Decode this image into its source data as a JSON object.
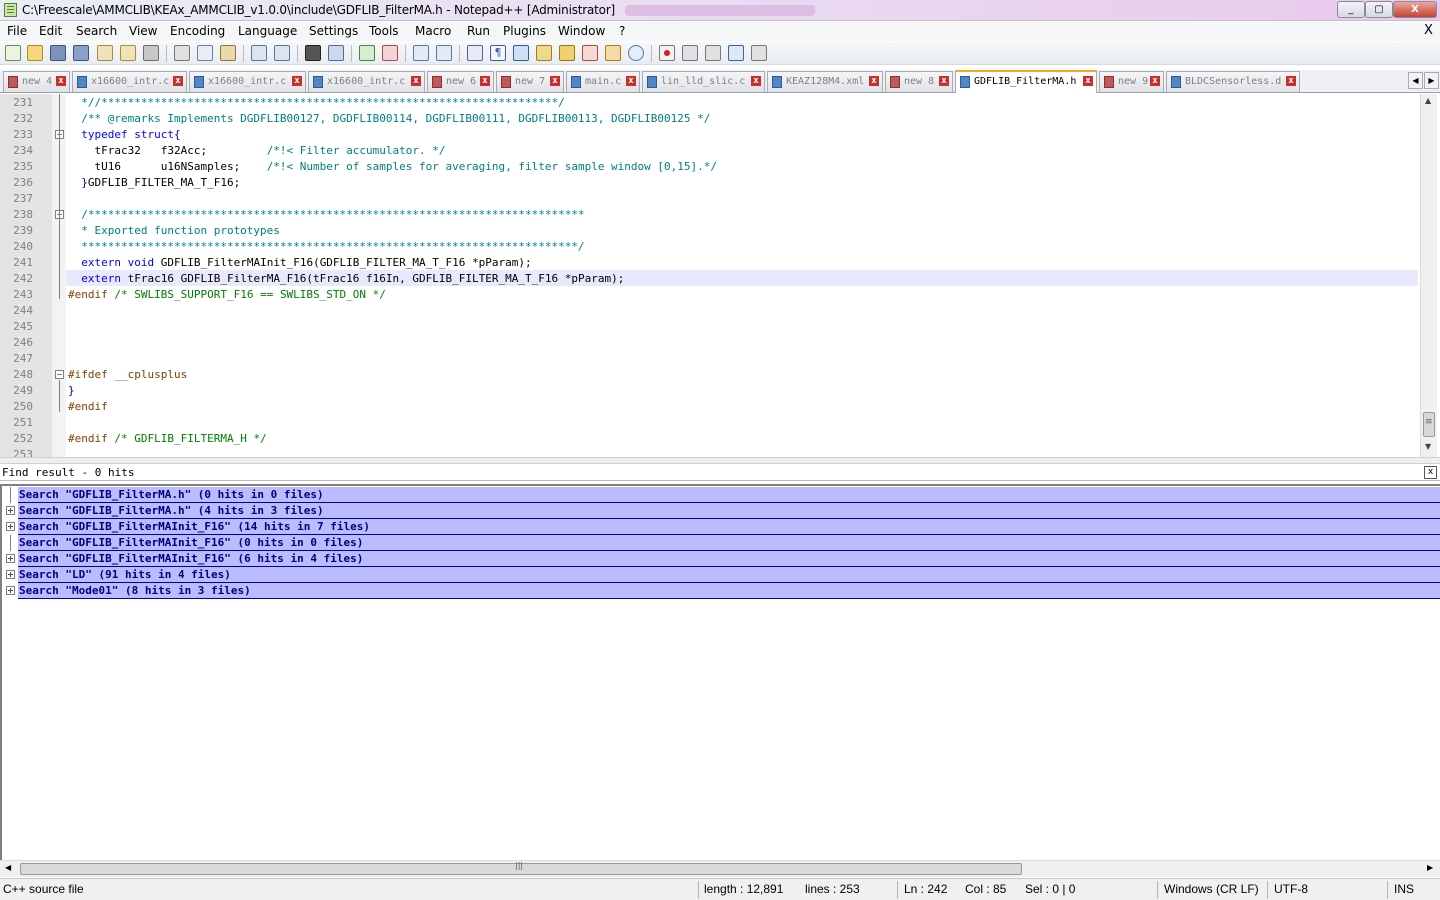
{
  "window": {
    "title": "C:\\Freescale\\AMMCLIB\\KEAx_AMMCLIB_v1.0.0\\include\\GDFLIB_FilterMA.h - Notepad++ [Administrator]",
    "min_label": "_",
    "max_label": "▢",
    "close_label": "X"
  },
  "menu": {
    "items": [
      "File",
      "Edit",
      "Search",
      "View",
      "Encoding",
      "Language",
      "Settings",
      "Tools",
      "Macro",
      "Run",
      "Plugins",
      "Window",
      "?"
    ],
    "close_label": "X"
  },
  "toolbar": {
    "icons": [
      "new-file-icon",
      "open-file-icon",
      "save-icon",
      "save-all-icon",
      "close-icon",
      "close-all-icon",
      "print-icon",
      "cut-icon",
      "copy-icon",
      "paste-icon",
      "undo-icon",
      "redo-icon",
      "find-icon",
      "replace-icon",
      "zoom-in-icon",
      "zoom-out-icon",
      "sync-vertical-icon",
      "sync-horizontal-icon",
      "word-wrap-icon",
      "show-all-chars-icon",
      "indent-guide-icon",
      "user-lang-icon",
      "doc-map-icon",
      "function-list-icon",
      "folder-workspace-icon",
      "monitoring-icon",
      "record-macro-icon",
      "stop-macro-icon",
      "play-macro-icon",
      "run-macro-multiple-icon",
      "save-macro-icon"
    ]
  },
  "tabs": [
    {
      "label": "new 4",
      "active": false,
      "unsaved": true
    },
    {
      "label": "x16600_intr.c",
      "active": false,
      "unsaved": false
    },
    {
      "label": "x16600_intr.c",
      "active": false,
      "unsaved": false
    },
    {
      "label": "x16600_intr.c",
      "active": false,
      "unsaved": false
    },
    {
      "label": "new 6",
      "active": false,
      "unsaved": true
    },
    {
      "label": "new 7",
      "active": false,
      "unsaved": true
    },
    {
      "label": "main.c",
      "active": false,
      "unsaved": false
    },
    {
      "label": "lin_lld_slic.c",
      "active": false,
      "unsaved": false
    },
    {
      "label": "KEAZ128M4.xml",
      "active": false,
      "unsaved": false
    },
    {
      "label": "new 8",
      "active": false,
      "unsaved": true
    },
    {
      "label": "GDFLIB_FilterMA.h",
      "active": true,
      "unsaved": false
    },
    {
      "label": "new 9",
      "active": false,
      "unsaved": true
    },
    {
      "label": "BLDCSensorless.d",
      "active": false,
      "unsaved": false
    }
  ],
  "tab_nav": {
    "prev": "◀",
    "next": "▶"
  },
  "editor": {
    "lines": [
      {
        "n": "231",
        "html": "<span class=\"cm\">  *//*********************************************************************/</span>"
      },
      {
        "n": "232",
        "html": "<span class=\"cm\">  /** @remarks Implements DGDFLIB00127, DGDFLIB00114, DGDFLIB00111, DGDFLIB00113, DGDFLIB00125 */</span>"
      },
      {
        "n": "233",
        "html": "  <span class=\"k\">typedef</span> <span class=\"k\">struct</span><span class=\"br\">{</span>"
      },
      {
        "n": "234",
        "html": "    tFrac32   f32Acc;         <span class=\"cm\">/*!&lt; Filter accumulator. */</span>"
      },
      {
        "n": "235",
        "html": "    tU16      u16NSamples;    <span class=\"cm\">/*!&lt; Number of samples for averaging, filter sample window [0,15].*/</span>"
      },
      {
        "n": "236",
        "html": "  <span class=\"br\">}</span>GDFLIB_FILTER_MA_T_F16;"
      },
      {
        "n": "237",
        "html": ""
      },
      {
        "n": "238",
        "html": "<span class=\"cm\">  /***************************************************************************</span>"
      },
      {
        "n": "239",
        "html": "<span class=\"cm\">  * Exported function prototypes</span>"
      },
      {
        "n": "240",
        "html": "<span class=\"cm\">  ***************************************************************************/</span>"
      },
      {
        "n": "241",
        "html": "  <span class=\"k\">extern</span> <span class=\"k\">void</span> GDFLIB_FilterMAInit_F16(GDFLIB_FILTER_MA_T_F16 *pParam);"
      },
      {
        "n": "242",
        "html": "  <span class=\"k\">extern</span> tFrac16 GDFLIB_FilterMA_F16(tFrac16 f16In, GDFLIB_FILTER_MA_T_F16 *pParam);"
      },
      {
        "n": "243",
        "html": "<span class=\"pp\">#endif</span> <span class=\"cg\">/* SWLIBS_SUPPORT_F16 == SWLIBS_STD_ON */</span>"
      },
      {
        "n": "244",
        "html": ""
      },
      {
        "n": "245",
        "html": ""
      },
      {
        "n": "246",
        "html": ""
      },
      {
        "n": "247",
        "html": ""
      },
      {
        "n": "248",
        "html": "<span class=\"pp\">#ifdef</span> <span class=\"pp\">__cplusplus</span>"
      },
      {
        "n": "249",
        "html": "<span class=\"br\">}</span>"
      },
      {
        "n": "250",
        "html": "<span class=\"pp\">#endif</span>"
      },
      {
        "n": "251",
        "html": ""
      },
      {
        "n": "252",
        "html": "<span class=\"pp\">#endif</span> <span class=\"cg\">/* GDFLIB_FILTERMA_H */</span>"
      },
      {
        "n": "253",
        "html": ""
      }
    ]
  },
  "find_panel": {
    "title": "Find result - 0 hits",
    "close_label": "x",
    "results": [
      {
        "text": "Search \"GDFLIB_FilterMA.h\" (0 hits in 0 files)",
        "expandable": false
      },
      {
        "text": "Search \"GDFLIB_FilterMA.h\" (4 hits in 3 files)",
        "expandable": true
      },
      {
        "text": "Search \"GDFLIB_FilterMAInit_F16\" (14 hits in 7 files)",
        "expandable": true
      },
      {
        "text": "Search \"GDFLIB_FilterMAInit_F16\" (0 hits in 0 files)",
        "expandable": false
      },
      {
        "text": "Search \"GDFLIB_FilterMAInit_F16\" (6 hits in 4 files)",
        "expandable": true
      },
      {
        "text": "Search \"LD\" (91 hits in 4 files)",
        "expandable": true
      },
      {
        "text": "Search \"Mode01\" (8 hits in 3 files)",
        "expandable": true
      }
    ]
  },
  "scrollbar": {
    "left": "◀",
    "right": "▶",
    "up": "▲",
    "down": "▼",
    "grip": "|||",
    "vgrip": "≡"
  },
  "status": {
    "file_type": "C++ source file",
    "length": "length : 12,891",
    "lines": "lines : 253",
    "ln": "Ln : 242",
    "col": "Col : 85",
    "sel": "Sel : 0 | 0",
    "eol": "Windows (CR LF)",
    "encoding": "UTF-8",
    "mode": "INS"
  },
  "colors": {
    "keyword": "#0000ff",
    "comment": "#008080",
    "comment_line": "#008000",
    "preprocessor": "#804000",
    "result_row": "#bbbbff",
    "current_line": "#e8e8ff"
  }
}
